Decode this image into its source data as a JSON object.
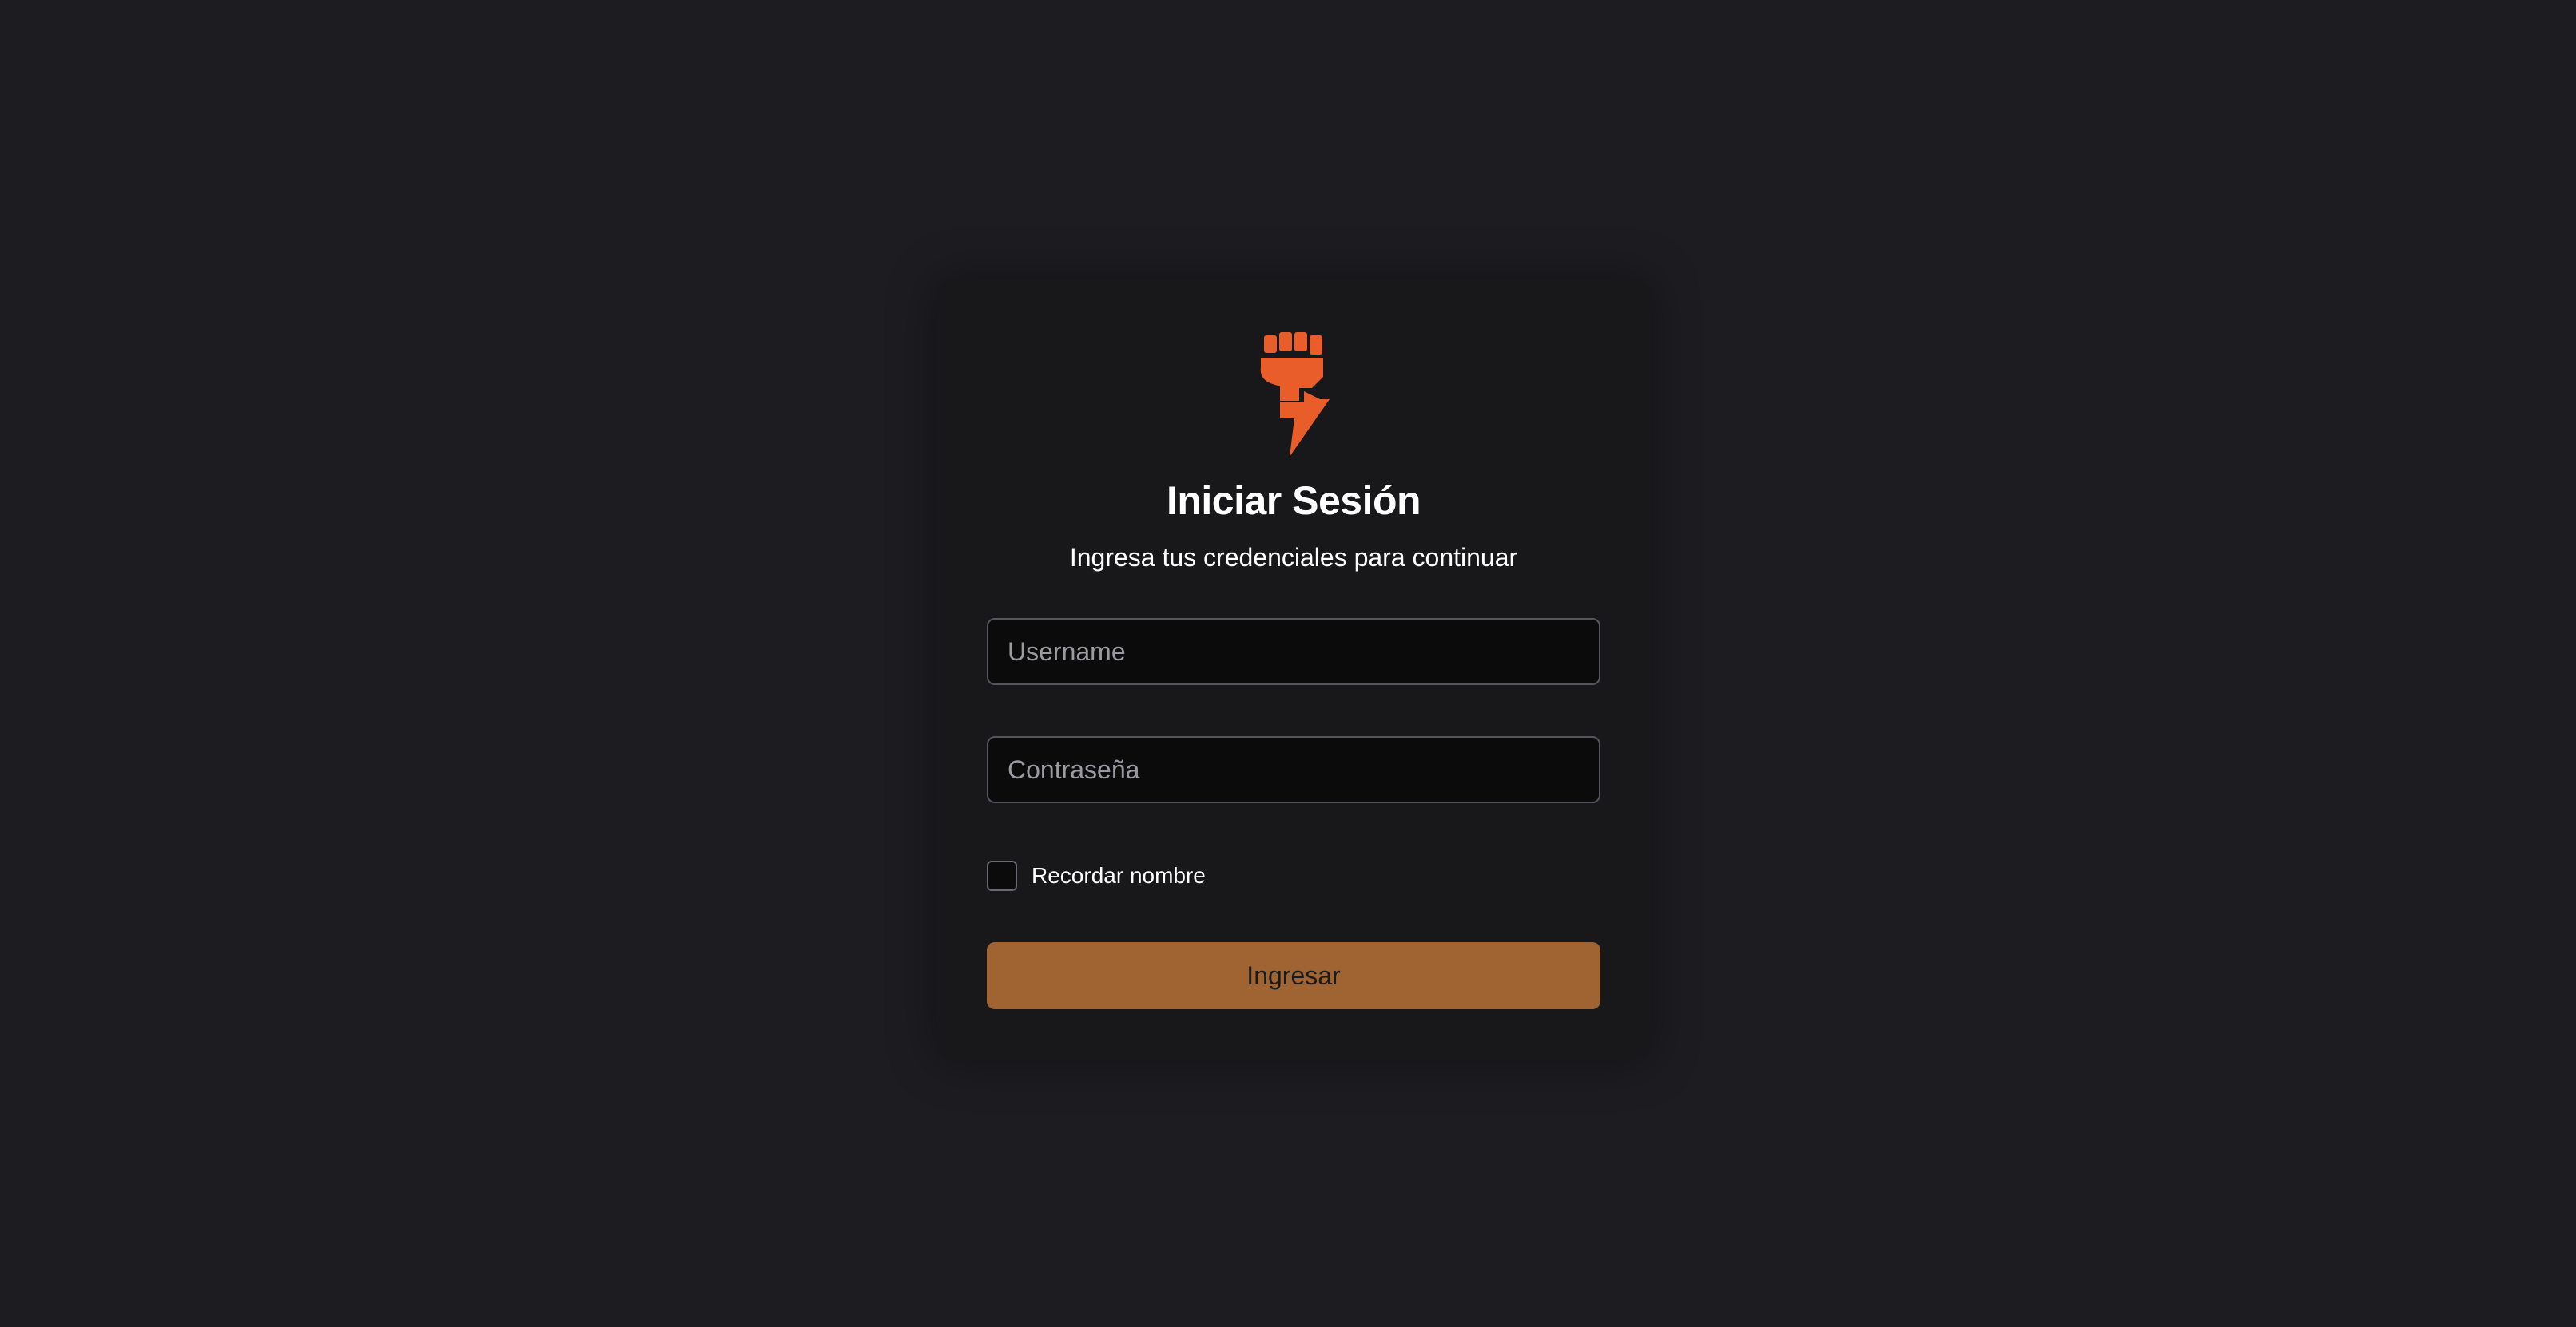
{
  "brand": {
    "logo_icon": "fist-lightning-icon",
    "accent_color": "#e85d2a"
  },
  "login": {
    "title": "Iniciar Sesión",
    "subtitle": "Ingresa tus credenciales para continuar",
    "username": {
      "value": "",
      "placeholder": "Username"
    },
    "password": {
      "value": "",
      "placeholder": "Contraseña"
    },
    "remember": {
      "label": "Recordar nombre",
      "checked": false
    },
    "submit_label": "Ingresar",
    "button_color": "#a06433"
  },
  "theme": {
    "background": "#1c1c21",
    "card_background": "#18181a"
  }
}
